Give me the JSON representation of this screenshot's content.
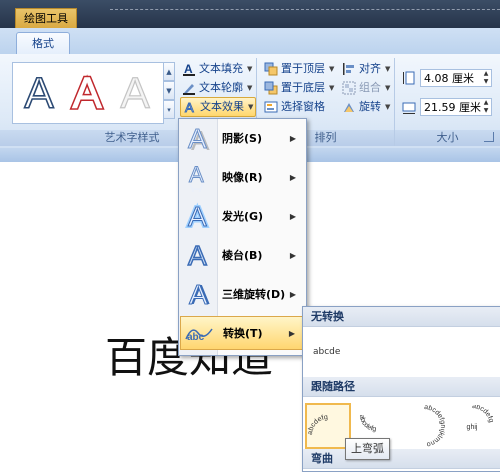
{
  "context_tab": "绘图工具",
  "ribbon_tab": "格式",
  "wordart_group": {
    "label": "艺术字样式",
    "gallery_letter": "A",
    "text_fill": "文本填充",
    "text_outline": "文本轮廓",
    "text_effects": "文本效果"
  },
  "arrange_group": {
    "label": "排列",
    "bring_to_front": "置于顶层",
    "send_to_back": "置于底层",
    "selection_pane": "选择窗格",
    "align": "对齐",
    "group": "组合",
    "rotate": "旋转"
  },
  "size_group": {
    "label": "大小",
    "height": "4.08 厘米",
    "width": "21.59 厘米"
  },
  "effects_menu": {
    "items": [
      {
        "label": "阴影(S)",
        "icon": "shadow-icon"
      },
      {
        "label": "映像(R)",
        "icon": "reflection-icon"
      },
      {
        "label": "发光(G)",
        "icon": "glow-icon"
      },
      {
        "label": "棱台(B)",
        "icon": "bevel-icon"
      },
      {
        "label": "三维旋转(D)",
        "icon": "3d-rotation-icon"
      },
      {
        "label": "转换(T)",
        "icon": "transform-icon"
      }
    ]
  },
  "transform_submenu": {
    "no_transform": "无转换",
    "no_transform_sample": "abcde",
    "follow_path": "跟随路径",
    "warp": "弯曲",
    "path_sample_arch": "abcdefg",
    "path_sample_circle": "abcdefghijklmno",
    "tooltip": "上弯弧"
  },
  "document": {
    "text": "百度知道"
  }
}
